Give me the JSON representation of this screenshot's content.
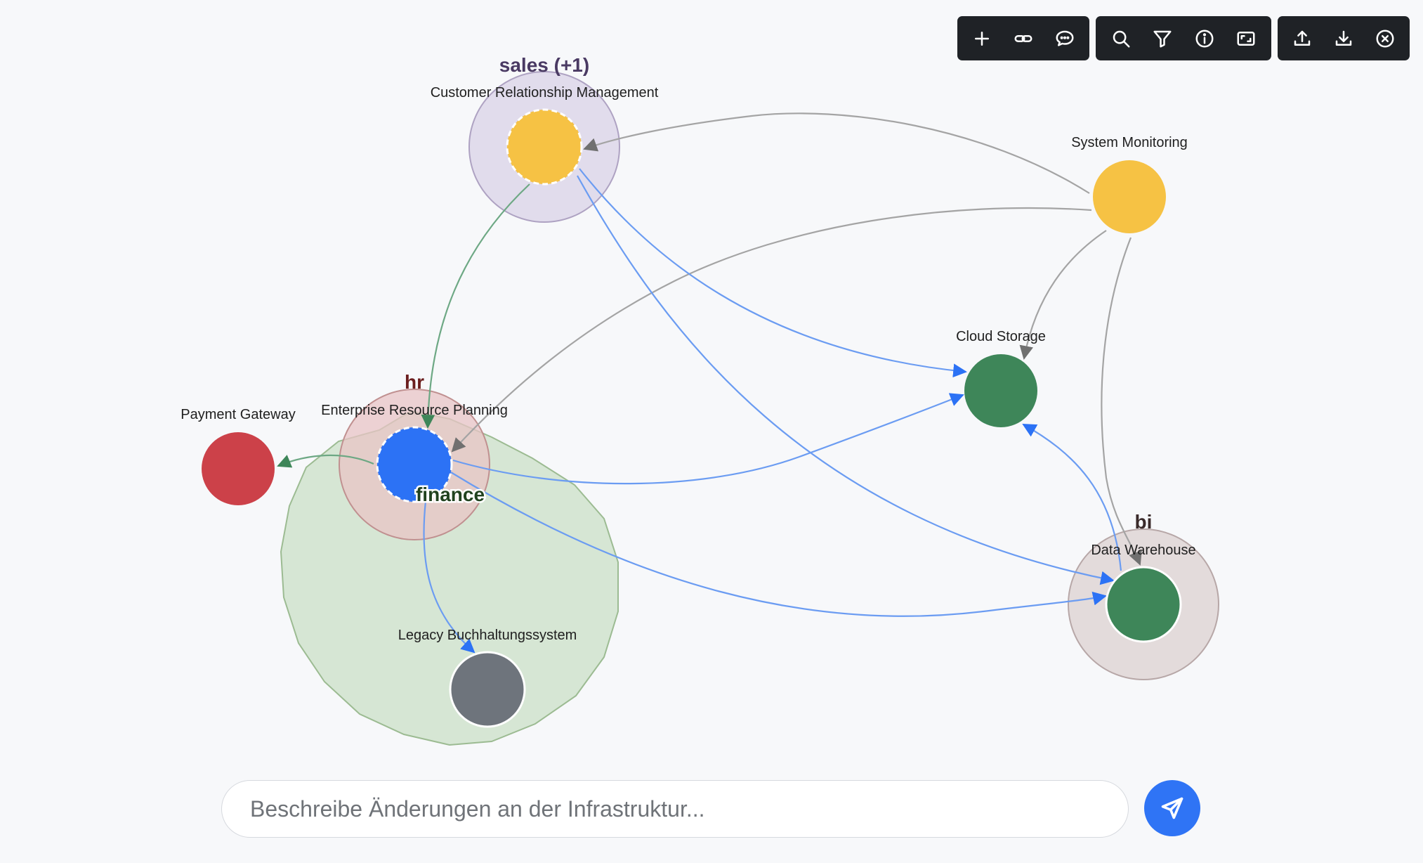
{
  "toolbar": {
    "groups": [
      [
        {
          "name": "add-icon",
          "label": "Add"
        },
        {
          "name": "link-icon",
          "label": "Link"
        },
        {
          "name": "comment-icon",
          "label": "Comment"
        }
      ],
      [
        {
          "name": "search-icon",
          "label": "Search"
        },
        {
          "name": "filter-icon",
          "label": "Filter"
        },
        {
          "name": "info-icon",
          "label": "Info"
        },
        {
          "name": "fit-screen-icon",
          "label": "Fit screen"
        }
      ],
      [
        {
          "name": "upload-icon",
          "label": "Upload"
        },
        {
          "name": "download-icon",
          "label": "Download"
        },
        {
          "name": "close-icon",
          "label": "Close"
        }
      ]
    ]
  },
  "colors": {
    "background": "#f7f8fa",
    "node_yellow": "#f6c244",
    "node_blue": "#2c72f5",
    "node_green": "#3e8659",
    "node_red": "#cc4149",
    "node_gray": "#6e747c",
    "edge_gray": "#a4a4a4",
    "edge_blue": "#6b9cf2",
    "edge_green": "#6da884",
    "accent": "#2f74f5"
  },
  "groups": [
    {
      "id": "sales",
      "label": "sales (+1)",
      "color": "#4a3a63"
    },
    {
      "id": "hr",
      "label": "hr",
      "color": "#6b1e1e"
    },
    {
      "id": "finance",
      "label": "finance",
      "color": "#21421f"
    },
    {
      "id": "bi",
      "label": "bi",
      "color": "#3a2a2a"
    }
  ],
  "nodes": [
    {
      "id": "crm",
      "label": "Customer Relationship Management",
      "color": "#f6c244",
      "selected": true
    },
    {
      "id": "monitoring",
      "label": "System Monitoring",
      "color": "#f6c244"
    },
    {
      "id": "cloud",
      "label": "Cloud Storage",
      "color": "#3e8659"
    },
    {
      "id": "erp",
      "label": "Enterprise Resource Planning",
      "color": "#2c72f5",
      "selected": true
    },
    {
      "id": "payment",
      "label": "Payment Gateway",
      "color": "#cc4149"
    },
    {
      "id": "legacy",
      "label": "Legacy Buchhaltungssystem",
      "color": "#6e747c"
    },
    {
      "id": "dwh",
      "label": "Data Warehouse",
      "color": "#3e8659"
    }
  ],
  "edges": [
    {
      "from": "monitoring",
      "to": "crm",
      "color": "gray"
    },
    {
      "from": "monitoring",
      "to": "erp",
      "color": "gray"
    },
    {
      "from": "monitoring",
      "to": "cloud",
      "color": "gray"
    },
    {
      "from": "monitoring",
      "to": "dwh",
      "color": "gray"
    },
    {
      "from": "crm",
      "to": "cloud",
      "color": "blue"
    },
    {
      "from": "crm",
      "to": "dwh",
      "color": "blue"
    },
    {
      "from": "crm",
      "to": "erp",
      "color": "green"
    },
    {
      "from": "erp",
      "to": "payment",
      "color": "green"
    },
    {
      "from": "erp",
      "to": "cloud",
      "color": "blue"
    },
    {
      "from": "erp",
      "to": "dwh",
      "color": "blue"
    },
    {
      "from": "erp",
      "to": "legacy",
      "color": "blue"
    },
    {
      "from": "dwh",
      "to": "cloud",
      "color": "blue"
    }
  ],
  "prompt": {
    "placeholder": "Beschreibe Änderungen an der Infrastruktur..."
  }
}
